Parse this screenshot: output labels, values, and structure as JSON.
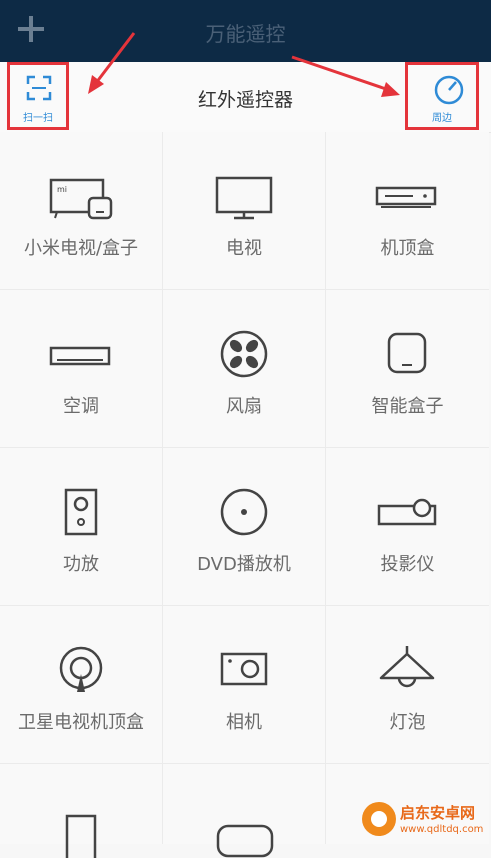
{
  "app": {
    "title": "万能遥控",
    "subtitle": "红外遥控器",
    "scan_label": "扫一扫",
    "around_label": "周边"
  },
  "devices": [
    {
      "label": "小米电视/盒子",
      "icon": "mi-tv-box-icon"
    },
    {
      "label": "电视",
      "icon": "tv-icon"
    },
    {
      "label": "机顶盒",
      "icon": "set-top-box-icon"
    },
    {
      "label": "空调",
      "icon": "air-conditioner-icon"
    },
    {
      "label": "风扇",
      "icon": "fan-icon"
    },
    {
      "label": "智能盒子",
      "icon": "smart-box-icon"
    },
    {
      "label": "功放",
      "icon": "amplifier-icon"
    },
    {
      "label": "DVD播放机",
      "icon": "dvd-player-icon"
    },
    {
      "label": "投影仪",
      "icon": "projector-icon"
    },
    {
      "label": "卫星电视机顶盒",
      "icon": "satellite-box-icon"
    },
    {
      "label": "相机",
      "icon": "camera-icon"
    },
    {
      "label": "灯泡",
      "icon": "lamp-icon"
    },
    {
      "label": "",
      "icon": "phone-icon"
    },
    {
      "label": "",
      "icon": "rounded-device-icon"
    },
    {
      "label": "",
      "icon": "unknown-device-icon"
    }
  ],
  "watermark": {
    "name": "启东安卓网",
    "url": "www.qdltdq.com"
  },
  "colors": {
    "header_bg": "#0d2a45",
    "accent": "#2f8bd6",
    "annotation_red": "#e4343b",
    "watermark_orange": "#e8691a"
  }
}
